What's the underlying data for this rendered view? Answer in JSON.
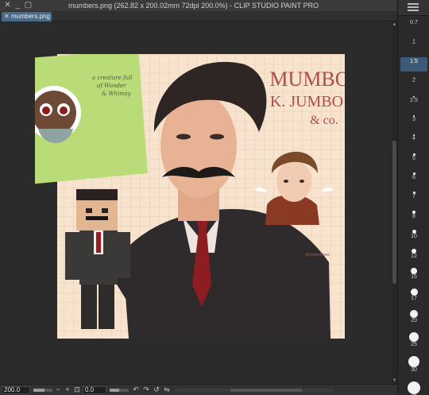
{
  "window": {
    "title": "mumbers.png (262.82 x 200.02mm 72dpi 200.0%)  - CLIP STUDIO PAINT PRO",
    "close_glyph": "✕",
    "minimize_glyph": "_",
    "maximize_glyph": "▢"
  },
  "tab": {
    "label": "mumbers.png",
    "close_glyph": "✕"
  },
  "artwork": {
    "title_line1": "MUMBO",
    "title_line2": "K. JUMBO",
    "title_line3": "& co.",
    "sticky_note_text": "a creature full of Wonder & Whimsy",
    "signature": "@emsedraws"
  },
  "brush_sizes": [
    {
      "label": "0.7",
      "dot": 0
    },
    {
      "label": "1",
      "dot": 1
    },
    {
      "label": "1.5",
      "dot": 1,
      "selected": true
    },
    {
      "label": "2",
      "dot": 1
    },
    {
      "label": "2.5",
      "dot": 2
    },
    {
      "label": "3",
      "dot": 2
    },
    {
      "label": "4",
      "dot": 2
    },
    {
      "label": "5",
      "dot": 3
    },
    {
      "label": "6",
      "dot": 3
    },
    {
      "label": "7",
      "dot": 3
    },
    {
      "label": "8",
      "dot": 4
    },
    {
      "label": "10",
      "dot": 5
    },
    {
      "label": "12",
      "dot": 6
    },
    {
      "label": "15",
      "dot": 8
    },
    {
      "label": "17",
      "dot": 9
    },
    {
      "label": "20",
      "dot": 10
    },
    {
      "label": "25",
      "dot": 12
    },
    {
      "label": "30",
      "dot": 14
    },
    {
      "label": "40",
      "dot": 16
    }
  ],
  "statusbar": {
    "zoom": "200.0",
    "rotation": "0.0",
    "zoom_out_glyph": "−",
    "zoom_in_glyph": "+",
    "fit_glyph": "⊡",
    "rotate_left_glyph": "↶",
    "rotate_right_glyph": "↷",
    "reset_glyph": "↺",
    "flip_glyph": "⇋"
  },
  "colors": {
    "canvas_bg": "#f6e4cf",
    "grid": "#e3b7a2",
    "title_text": "#b24a4a",
    "sticky_note": "#b9dc78",
    "accent_selected": "#3c5a78"
  },
  "icons": {
    "panel_menu": "hamburger-icon"
  }
}
